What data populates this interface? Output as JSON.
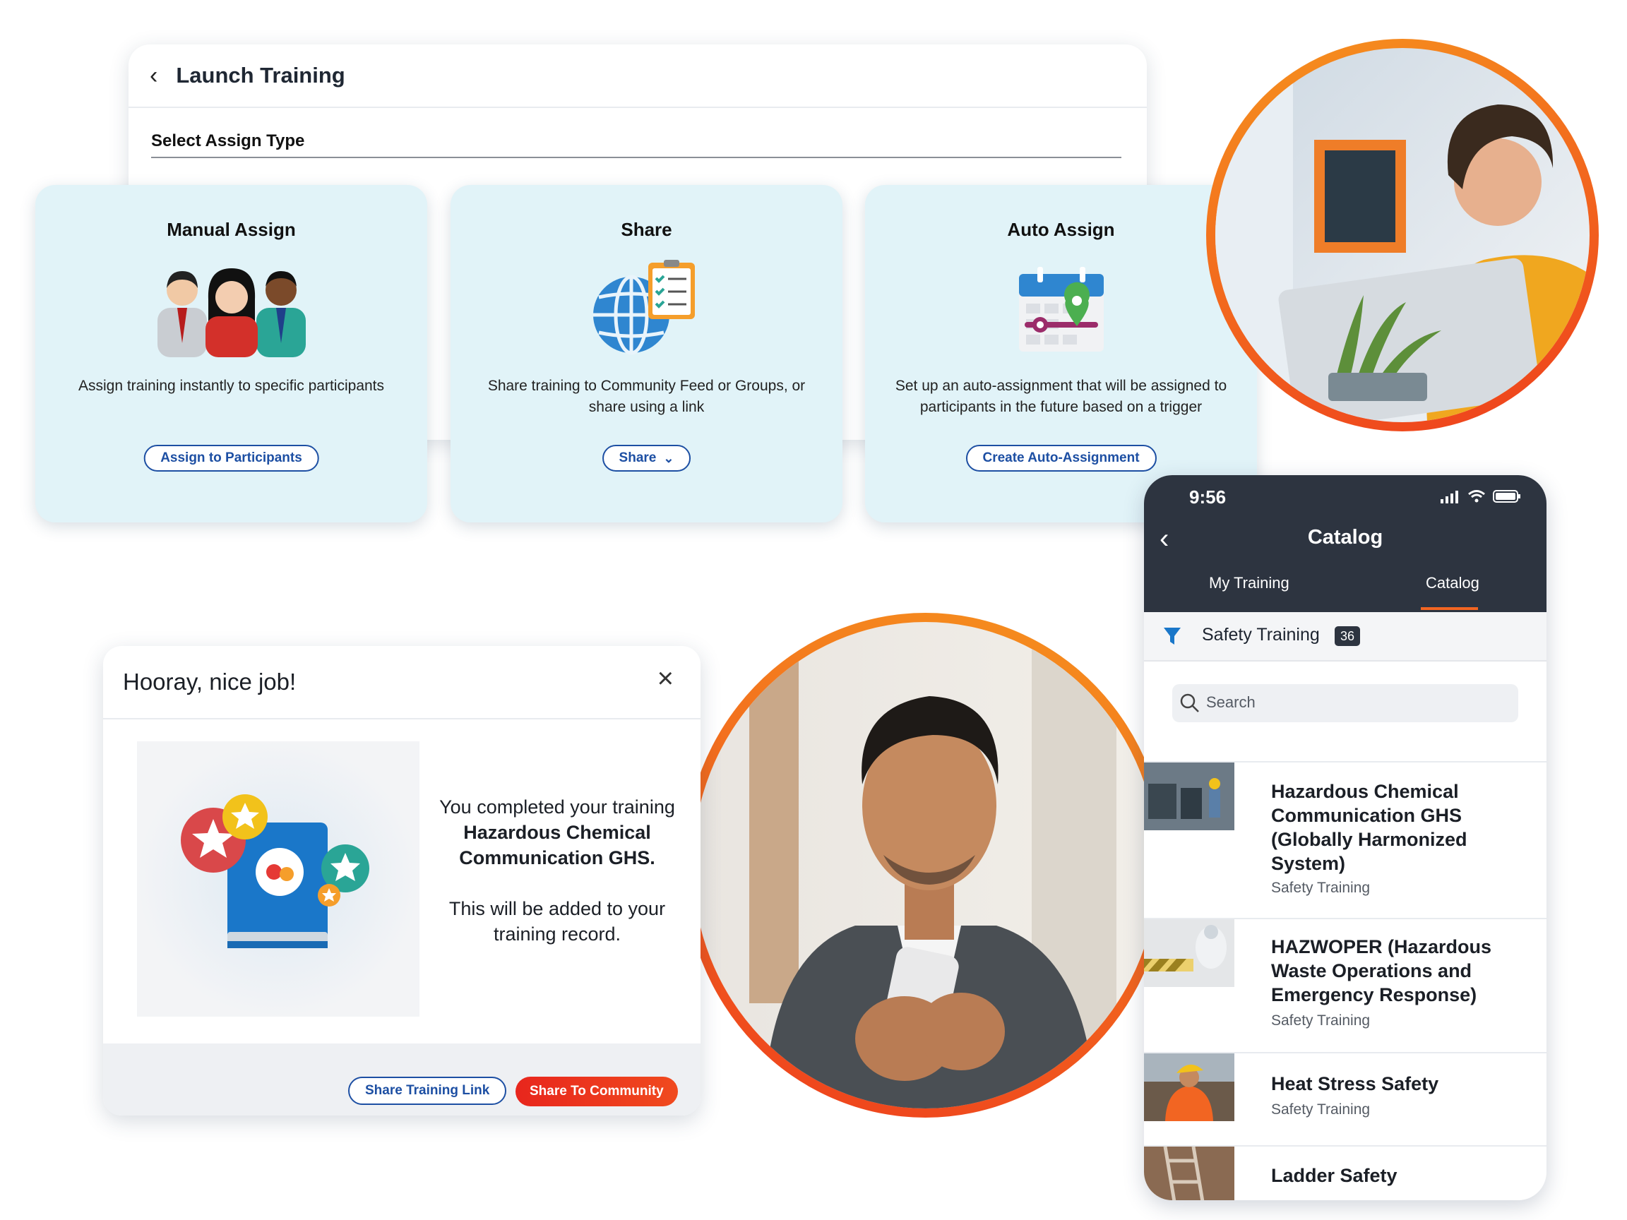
{
  "launch": {
    "title": "Launch Training",
    "assign_type_label": "Select Assign Type",
    "cards": [
      {
        "title": "Manual Assign",
        "description": "Assign training instantly to specific participants",
        "button": "Assign to Participants"
      },
      {
        "title": "Share",
        "description": "Share training to Community Feed or Groups, or share using a link",
        "button": "Share"
      },
      {
        "title": "Auto Assign",
        "description": "Set up an auto-assignment that will be assigned to participants in the future based on a trigger",
        "button": "Create Auto-Assignment"
      }
    ]
  },
  "modal": {
    "title": "Hooray, nice job!",
    "message_line1": "You completed your training",
    "course_name": "Hazardous Chemical Communication GHS.",
    "message_line2": "This will be added to your training record.",
    "share_link_button": "Share Training Link",
    "share_community_button": "Share To Community"
  },
  "phone": {
    "time": "9:56",
    "title": "Catalog",
    "tabs": [
      "My Training",
      "Catalog"
    ],
    "active_tab": "Catalog",
    "filter_label": "Safety Training",
    "filter_count": "36",
    "search_placeholder": "Search",
    "items": [
      {
        "title": "Hazardous Chemical Communication GHS (Globally Harmonized System)",
        "category": "Safety Training"
      },
      {
        "title": "HAZWOPER (Hazardous Waste Operations and Emergency Response)",
        "category": "Safety Training"
      },
      {
        "title": "Heat Stress Safety",
        "category": "Safety Training"
      },
      {
        "title": "Ladder Safety",
        "category": ""
      }
    ]
  },
  "colors": {
    "accent_orange": "#f26522",
    "accent_red": "#e8261d",
    "primary_blue": "#1d4fa3",
    "card_bg": "#e1f3f8",
    "phone_header": "#2d3440"
  },
  "icons": [
    "back-chevron-icon",
    "participants-icon",
    "globe-checklist-icon",
    "calendar-pin-icon",
    "close-icon",
    "chevron-down-icon",
    "filter-icon",
    "search-icon",
    "signal-icon",
    "wifi-icon",
    "battery-icon"
  ]
}
